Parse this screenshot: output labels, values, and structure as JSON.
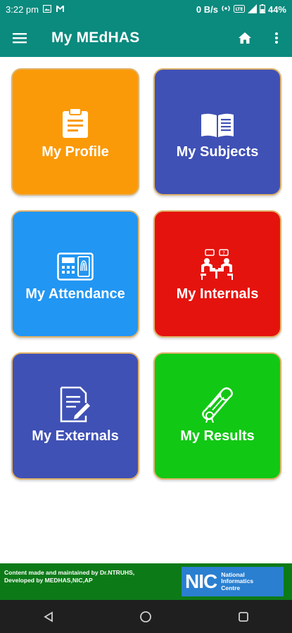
{
  "status_bar": {
    "time": "3:22 pm",
    "net_speed": "0 B/s",
    "battery": "44%"
  },
  "app_bar": {
    "title": "My MEdHAS"
  },
  "tiles": [
    {
      "label": "My Profile",
      "color": "#fb9a08",
      "icon": "clipboard-icon"
    },
    {
      "label": "My Subjects",
      "color": "#3f51b5",
      "icon": "open-book-icon"
    },
    {
      "label": "My Attendance",
      "color": "#2196f3",
      "icon": "biometric-device-icon"
    },
    {
      "label": "My Internals",
      "color": "#e5130d",
      "icon": "exam-meeting-icon"
    },
    {
      "label": "My Externals",
      "color": "#3f51b5",
      "icon": "document-edit-icon"
    },
    {
      "label": "My Results",
      "color": "#11c814",
      "icon": "diploma-scroll-icon"
    }
  ],
  "footer": {
    "line1": "Content made and maintained by Dr.NTRUHS,",
    "line2": "Developed by MEDHAS,NIC,AP",
    "logo_abbr": "NIC",
    "logo_line1": "National",
    "logo_line2": "Informatics",
    "logo_line3": "Centre"
  },
  "colors": {
    "primary": "#0b8a7e",
    "footer": "#0d7a18",
    "nav": "#1f1f1f"
  }
}
